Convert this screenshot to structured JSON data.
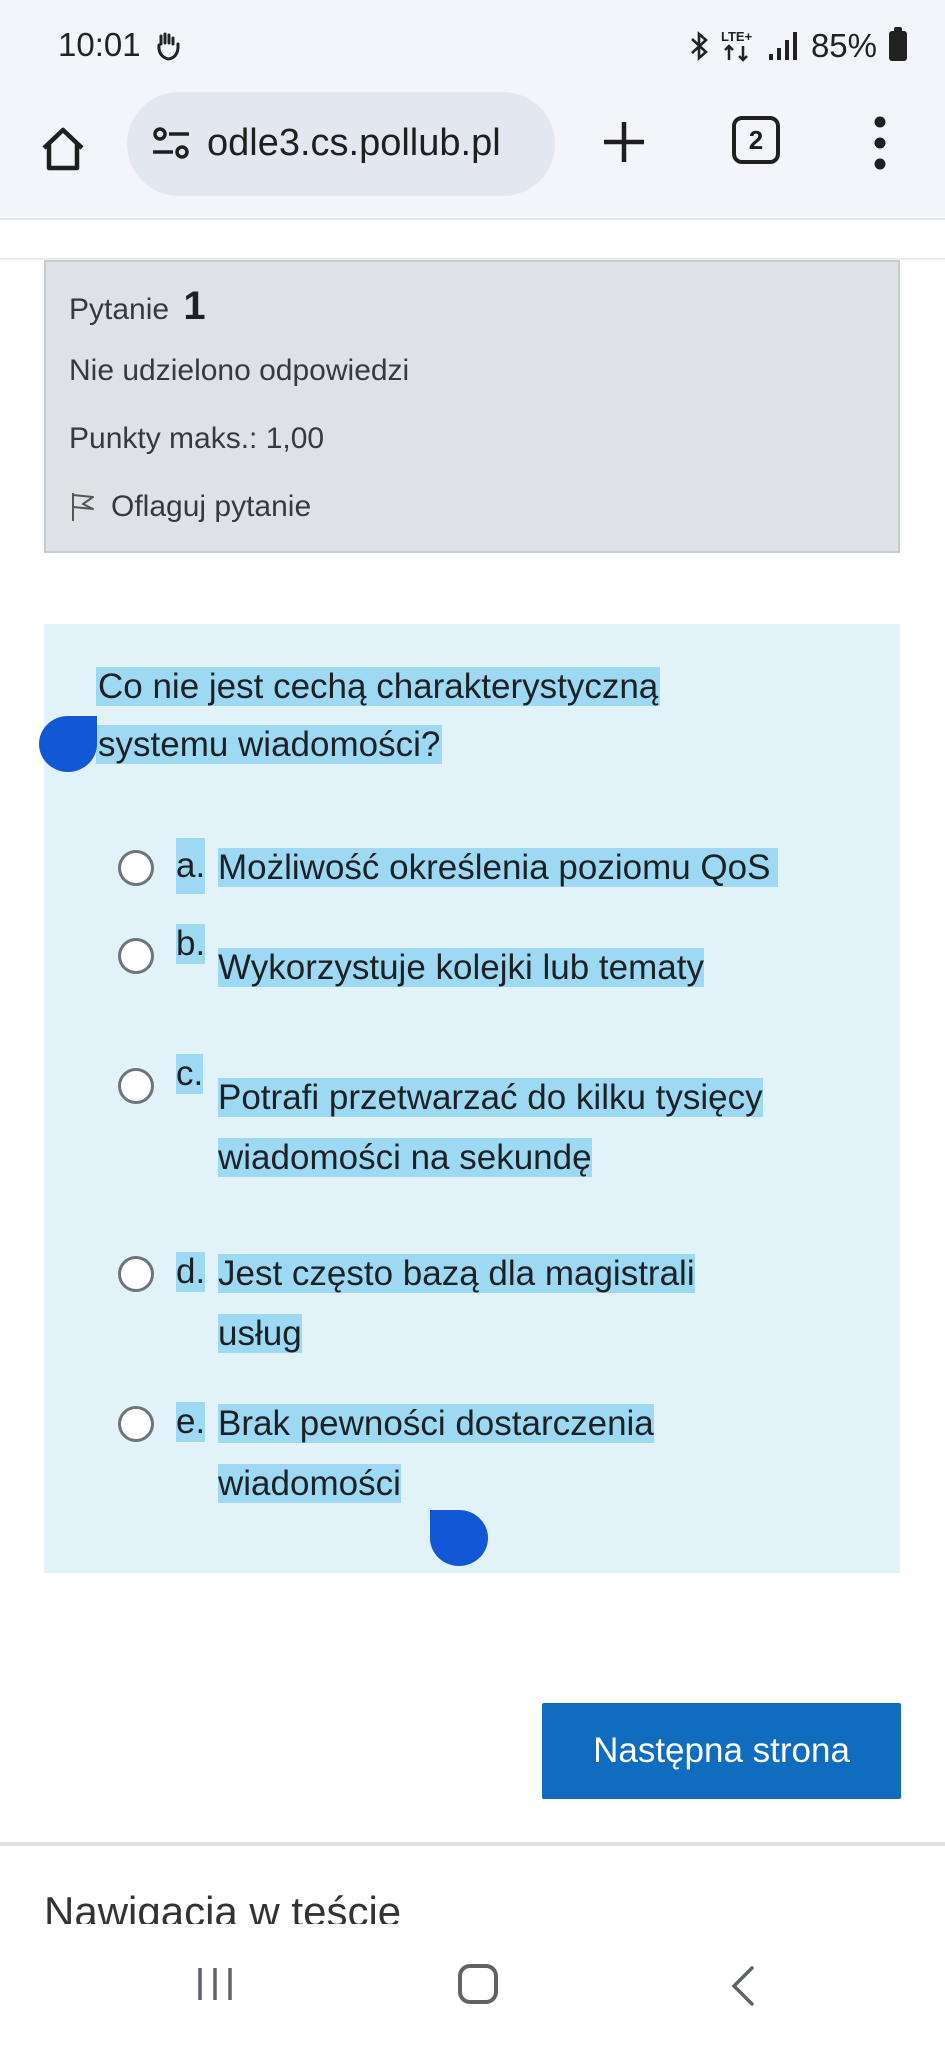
{
  "status_bar": {
    "time": "10:01",
    "network": "LTE+",
    "battery": "85%"
  },
  "browser": {
    "url": "odle3.cs.pollub.pl",
    "tab_count": "2"
  },
  "question_info": {
    "label": "Pytanie",
    "number": "1",
    "status": "Nie udzielono odpowiedzi",
    "points": "Punkty maks.: 1,00",
    "flag_label": "Oflaguj pytanie"
  },
  "question": {
    "line1": "Co nie jest cechą charakterystyczną",
    "line2": "systemu wiadomości?",
    "answers": [
      {
        "letter": "a.",
        "lines": [
          "Możliwość określenia poziomu QoS"
        ]
      },
      {
        "letter": "b.",
        "lines": [
          "Wykorzystuje kolejki lub tematy"
        ]
      },
      {
        "letter": "c.",
        "lines": [
          "Potrafi przetwarzać do kilku tysięcy",
          "wiadomości na sekundę"
        ]
      },
      {
        "letter": "d.",
        "lines": [
          "Jest często bazą dla magistrali",
          "usług"
        ]
      },
      {
        "letter": "e.",
        "lines": [
          "Brak pewności dostarczenia",
          "wiadomości"
        ]
      }
    ]
  },
  "actions": {
    "next_label": "Następna strona"
  },
  "quiz_nav": {
    "heading": "Nawigacja w teście"
  },
  "colors": {
    "primary_button": "#0f6cbf",
    "selection": "#9dd9f3",
    "selection_handle": "#1157d6",
    "question_bg": "#e1f2f8",
    "info_bg": "#dee2e6"
  }
}
